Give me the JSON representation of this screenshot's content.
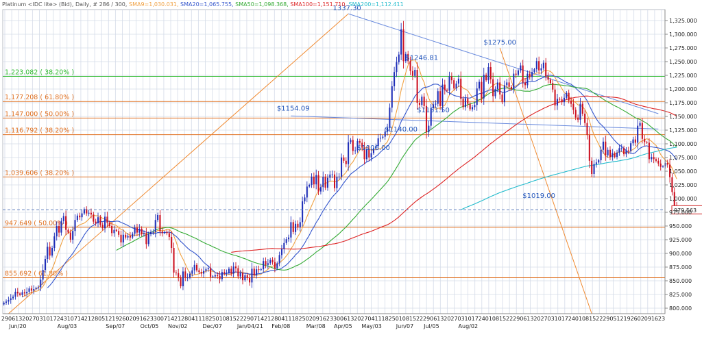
{
  "header": {
    "instrument": "Platinum <IDC lite> (Bid), Daily, # 286 / 300,",
    "indicators": [
      {
        "text": "SMA9=1,030.031,",
        "color": "#f0a040"
      },
      {
        "text": "SMA20=1,065.755,",
        "color": "#3355cc"
      },
      {
        "text": "SMA50=1,098.368,",
        "color": "#33aa33"
      },
      {
        "text": "SMA100=1,151.710,",
        "color": "#dd2222"
      },
      {
        "text": "SMA200=1,112.411",
        "color": "#22bbcc"
      }
    ]
  },
  "colors": {
    "up": "#1f2fb8",
    "down": "#cc1020",
    "grid": "#d4dbe8",
    "axis": "#888888",
    "sma9": "#f0a040",
    "sma20": "#3355cc",
    "sma50": "#33aa33",
    "sma100": "#dd2222",
    "sma200": "#22bbcc",
    "trendline": "#6688dd",
    "fan": "#f08a30",
    "fib_orange": "#e07020",
    "fib_green": "#33bb33",
    "label_blue": "#2255bb",
    "current_price_box": "#cc2222"
  },
  "chart_data": {
    "type": "candlestick",
    "y_axis_side": "right",
    "ylim": [
      790,
      1345
    ],
    "yticks": [
      "1,325.000",
      "1,300.000",
      "1,275.000",
      "1,250.000",
      "1,225.000",
      "1,200.000",
      "1,175.000",
      "1,150.000",
      "1,125.000",
      "1,100.000",
      "1,075.000",
      "1,050.000",
      "1,025.000",
      "1,000.000",
      "975.000",
      "950.000",
      "925.000",
      "900.000",
      "875.000",
      "850.000",
      "825.000",
      "800.000"
    ],
    "ytick_values": [
      1325,
      1300,
      1275,
      1250,
      1225,
      1200,
      1175,
      1150,
      1125,
      1100,
      1075,
      1050,
      1025,
      1000,
      975,
      950,
      925,
      900,
      875,
      850,
      825,
      800
    ],
    "xticks": [
      "29",
      "06",
      "13",
      "20",
      "27",
      "03",
      "10",
      "17",
      "24",
      "31",
      "07",
      "14",
      "21",
      "28",
      "05",
      "12",
      "19",
      "26",
      "02",
      "09",
      "16",
      "23",
      "30",
      "07",
      "14",
      "21",
      "28",
      "04",
      "11",
      "18",
      "25",
      "01",
      "08",
      "15",
      "22",
      "29",
      "07",
      "14",
      "21",
      "28",
      "04",
      "11",
      "18",
      "25",
      "02",
      "09",
      "16",
      "23",
      "30",
      "06",
      "13",
      "20",
      "27",
      "04",
      "11",
      "18",
      "25",
      "01",
      "08",
      "15",
      "22",
      "29",
      "06",
      "13",
      "20",
      "27",
      "03",
      "10",
      "17",
      "24",
      "01",
      "08",
      "15",
      "22",
      "29",
      "06",
      "13",
      "20",
      "27",
      "03",
      "10",
      "17",
      "24",
      "01",
      "08",
      "15",
      "22",
      "29",
      "05",
      "12",
      "19",
      "26",
      "02",
      "09",
      "16",
      "23"
    ],
    "xperiods": [
      "Jun/20",
      "Aug/03",
      "Sep/07",
      "Oct/05",
      "Nov/02",
      "Dec/07",
      "Jan/04/21",
      "Feb/08",
      "Mar/08",
      "Apr/05",
      "May/03",
      "Jun/07",
      "Jul/05",
      "Aug/02"
    ],
    "grid": true,
    "n_bars": 286,
    "closes": [
      810,
      812,
      815,
      818,
      821,
      830,
      827,
      824,
      829,
      827,
      830,
      836,
      832,
      835,
      837,
      838,
      852,
      870,
      890,
      912,
      896,
      910,
      931,
      950,
      938,
      959,
      968,
      943,
      938,
      925,
      941,
      961,
      969,
      966,
      973,
      981,
      973,
      974,
      971,
      958,
      955,
      966,
      952,
      946,
      967,
      956,
      950,
      937,
      943,
      941,
      934,
      920,
      934,
      929,
      932,
      929,
      936,
      947,
      938,
      945,
      935,
      937,
      917,
      935,
      939,
      939,
      961,
      970,
      940,
      937,
      939,
      937,
      930,
      910,
      865,
      864,
      856,
      840,
      867,
      856,
      856,
      863,
      869,
      879,
      869,
      866,
      863,
      868,
      871,
      873,
      857,
      858,
      860,
      859,
      853,
      866,
      864,
      864,
      872,
      863,
      876,
      873,
      858,
      864,
      851,
      860,
      855,
      847,
      872,
      860,
      871,
      870,
      871,
      886,
      879,
      882,
      888,
      884,
      873,
      882,
      897,
      908,
      919,
      926,
      929,
      957,
      939,
      954,
      948,
      957,
      995,
      1002,
      1022,
      1025,
      1040,
      1026,
      1043,
      1013,
      1021,
      1040,
      1020,
      1038,
      1044,
      1044,
      1019,
      1040,
      1040,
      1075,
      1069,
      1063,
      1103,
      1107,
      1087,
      1088,
      1105,
      1102,
      1093,
      1072,
      1090,
      1075,
      1083,
      1092,
      1096,
      1110,
      1111,
      1113,
      1122,
      1129,
      1166,
      1205,
      1231,
      1249,
      1263,
      1309,
      1251,
      1264,
      1251,
      1233,
      1224,
      1235,
      1175,
      1171,
      1186,
      1169,
      1121,
      1133,
      1165,
      1172,
      1173,
      1196,
      1169,
      1208,
      1198,
      1197,
      1223,
      1216,
      1201,
      1210,
      1219,
      1182,
      1167,
      1183,
      1173,
      1163,
      1167,
      1171,
      1201,
      1213,
      1183,
      1226,
      1216,
      1240,
      1218,
      1187,
      1200,
      1212,
      1190,
      1176,
      1207,
      1212,
      1204,
      1200,
      1228,
      1226,
      1234,
      1243,
      1212,
      1207,
      1228,
      1222,
      1231,
      1236,
      1251,
      1234,
      1238,
      1248,
      1223,
      1217,
      1211,
      1199,
      1170,
      1182,
      1181,
      1176,
      1184,
      1193,
      1179,
      1173,
      1162,
      1148,
      1144,
      1173,
      1155,
      1138,
      1116,
      1069,
      1045,
      1063,
      1066,
      1070,
      1089,
      1104,
      1079,
      1089,
      1076,
      1083,
      1076,
      1084,
      1092,
      1092,
      1081,
      1088,
      1087,
      1101,
      1108,
      1102,
      1133,
      1138,
      1109,
      1103,
      1102,
      1072,
      1076,
      1072,
      1069,
      1064,
      1058,
      1059,
      1065,
      1062,
      1039,
      1012,
      986,
      978
    ],
    "moving_averages": [
      {
        "name": "SMA9",
        "period": 9,
        "last": 1030.031
      },
      {
        "name": "SMA20",
        "period": 20,
        "last": 1065.755
      },
      {
        "name": "SMA50",
        "period": 50,
        "last": 1098.368
      },
      {
        "name": "SMA100",
        "period": 100,
        "last": 1151.71
      },
      {
        "name": "SMA200",
        "period": 200,
        "last": 1112.411
      }
    ],
    "fib_levels": [
      {
        "label": "1,223.082 ( 38.20% )",
        "value": 1223.082,
        "color": "green"
      },
      {
        "label": "1,177.208 ( 61.80% )",
        "value": 1177.208,
        "color": "orange"
      },
      {
        "label": "1,147.000 ( 50.00% )",
        "value": 1147.0,
        "color": "orange"
      },
      {
        "label": "1,116.792 ( 38.20% )",
        "value": 1116.792,
        "color": "orange"
      },
      {
        "label": "1,039.606 ( 38.20% )",
        "value": 1039.606,
        "color": "orange"
      },
      {
        "label": "947.649 ( 50.00% )",
        "value": 947.649,
        "color": "orange"
      },
      {
        "label": "855.692 ( 61.80% )",
        "value": 855.692,
        "color": "orange"
      }
    ],
    "annotations": [
      {
        "text": "1337.30",
        "bar": 150,
        "value": 1337.3
      },
      {
        "text": "$1275.00",
        "bar": 216,
        "value": 1275
      },
      {
        "text": "$1246.81",
        "bar": 182,
        "value": 1246.81
      },
      {
        "text": "$1154.09",
        "bar": 126,
        "value": 1154.09
      },
      {
        "text": "$1151.50",
        "bar": 187,
        "value": 1151.5
      },
      {
        "text": "$1140.00",
        "bar": 173,
        "value": 1140
      },
      {
        "text": "$1106.00",
        "bar": 161,
        "value": 1106
      },
      {
        "text": "$1019.00",
        "bar": 233,
        "value": 1019
      }
    ],
    "current_price": {
      "text": "979.563",
      "value": 979.563
    },
    "trendlines": [
      {
        "kind": "resistance",
        "from": {
          "bar": 150,
          "value": 1337.3
        },
        "to": {
          "bar": 285,
          "value": 1155
        }
      },
      {
        "kind": "support",
        "from": {
          "bar": 125,
          "value": 1151
        },
        "to": {
          "bar": 285,
          "value": 1127
        }
      }
    ],
    "fan_lines": [
      {
        "from": {
          "bar": 2,
          "value": 790
        },
        "to": {
          "bar": 150,
          "value": 1337.3
        }
      },
      {
        "from": {
          "bar": 216,
          "value": 1275
        },
        "to": {
          "bar": 256,
          "value": 790
        }
      }
    ]
  }
}
